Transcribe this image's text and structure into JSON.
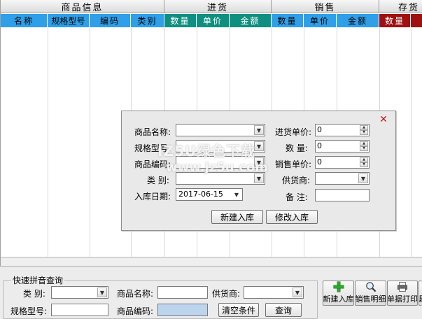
{
  "header": {
    "groups": [
      "商品信息",
      "进货",
      "销售",
      "存货"
    ],
    "columns": [
      "名称",
      "规格型号",
      "编码",
      "类别",
      "数量",
      "单价",
      "金额",
      "数量",
      "单价",
      "金额",
      "数量",
      ""
    ]
  },
  "dialog": {
    "labels": {
      "name": "商品名称:",
      "spec": "规格型号:",
      "code": "商品编码:",
      "category": "类 别:",
      "date": "入库日期:",
      "purchase_price": "进货单价:",
      "quantity": "数 量:",
      "sale_price": "销售单价:",
      "supplier": "供货商:",
      "remark": "备 注:"
    },
    "values": {
      "date": "2017-06-15",
      "purchase_price": "0",
      "quantity": "0",
      "sale_price": "0"
    },
    "buttons": {
      "new": "新建入库",
      "modify": "修改入库"
    },
    "close_glyph": "✕"
  },
  "watermark": {
    "line1": "IZ5U绿色下载",
    "line2": "www.jz5u.com"
  },
  "search": {
    "legend": "快速拼音查询",
    "labels": {
      "category": "类 别:",
      "name": "商品名称:",
      "supplier": "供货商:",
      "spec": "规格型号:",
      "code": "商品编码:"
    },
    "buttons": {
      "clear": "清空条件",
      "query": "查询"
    }
  },
  "toolbar": {
    "new_stock": "新建入库",
    "sales_detail": "销售明细",
    "print": "单据打印",
    "more": "退"
  },
  "colors": {
    "header_blue": "#2f9fe8",
    "header_teal": "#0f8f80",
    "header_red": "#a01010",
    "plus_green": "#2fa82f"
  }
}
